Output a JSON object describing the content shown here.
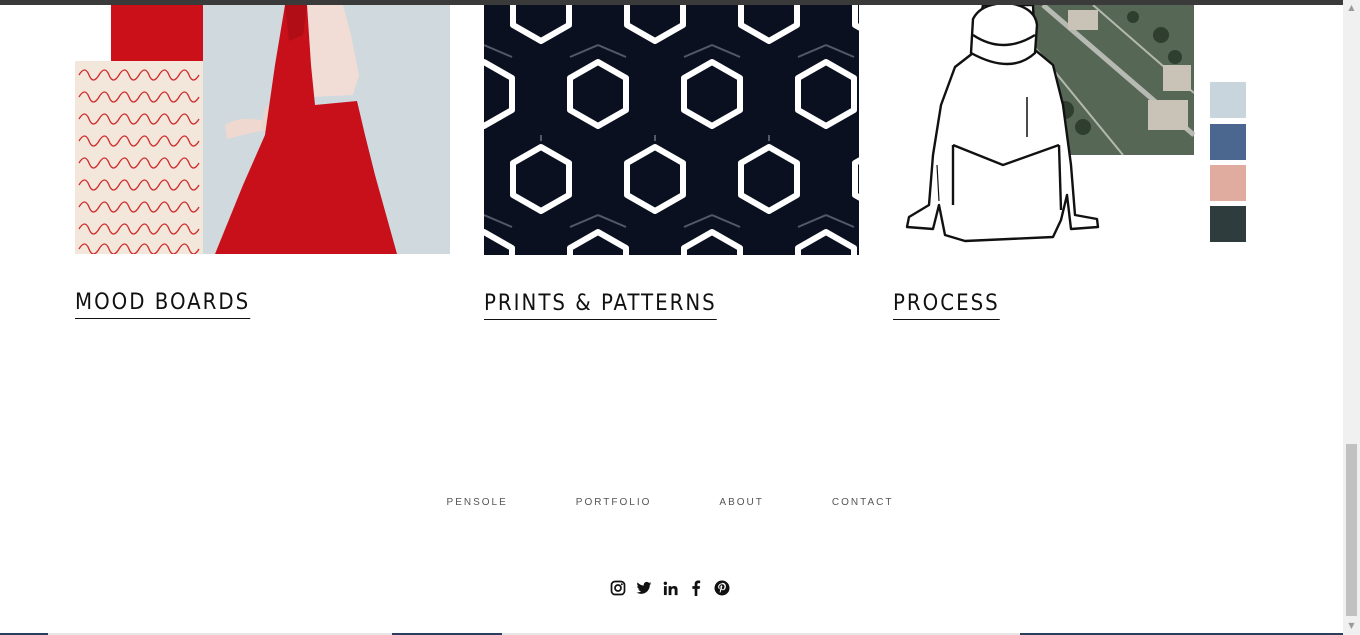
{
  "cards": [
    {
      "title": "MOOD BOARDS",
      "image": "red-dress-moodboard"
    },
    {
      "title": "PRINTS & PATTERNS",
      "image": "hexagon-pattern"
    },
    {
      "title": "PROCESS",
      "image": "hoodie-sketch-with-swatches"
    }
  ],
  "colors": {
    "dress_red": "#c8101a",
    "pattern_navy": "#0b1020",
    "swatches": [
      "#c9d5dc",
      "#4b678f",
      "#e0aca0",
      "#2f3c3e"
    ]
  },
  "footer": {
    "nav": [
      "PENSOLE",
      "PORTFOLIO",
      "ABOUT",
      "CONTACT"
    ],
    "social_icons": [
      "instagram-icon",
      "twitter-icon",
      "linkedin-icon",
      "facebook-icon",
      "pinterest-icon"
    ]
  }
}
